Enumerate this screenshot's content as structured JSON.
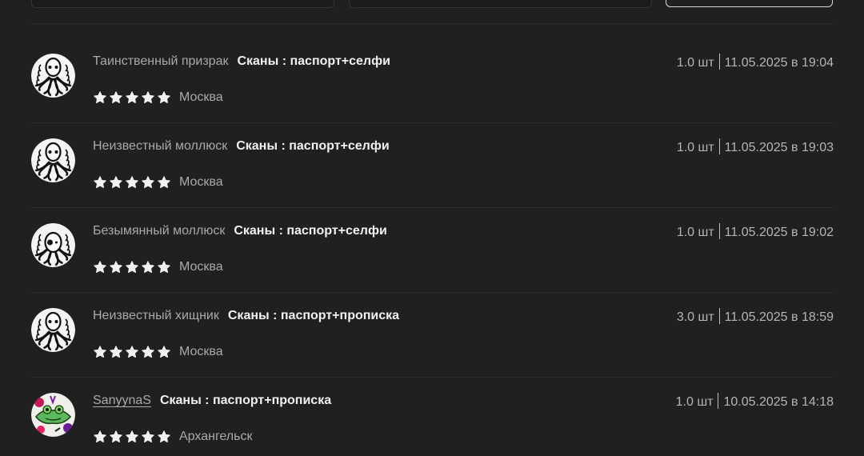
{
  "reviews": [
    {
      "username": "Таинственный призрак",
      "product": "Сканы : паспорт+селфи",
      "quantity": "1.0 шт",
      "datetime": "11.05.2025 в 19:04",
      "rating": 5,
      "city": "Москва",
      "avatar": "octopus-avatar"
    },
    {
      "username": "Неизвестный моллюск",
      "product": "Сканы : паспорт+селфи",
      "quantity": "1.0 шт",
      "datetime": "11.05.2025 в 19:03",
      "rating": 5,
      "city": "Москва",
      "avatar": "octopus-avatar"
    },
    {
      "username": "Безымянный моллюск",
      "product": "Сканы : паспорт+селфи",
      "quantity": "1.0 шт",
      "datetime": "11.05.2025 в 19:02",
      "rating": 5,
      "city": "Москва",
      "avatar": "octopus-avatar"
    },
    {
      "username": "Неизвестный хищник",
      "product": "Сканы : паспорт+прописка",
      "quantity": "3.0 шт",
      "datetime": "11.05.2025 в 18:59",
      "rating": 5,
      "city": "Москва",
      "avatar": "octopus-avatar"
    },
    {
      "username": "SanyynaS",
      "product": "Сканы : паспорт+прописка",
      "quantity": "1.0 шт",
      "datetime": "10.05.2025 в 14:18",
      "rating": 5,
      "city": "Архангельск",
      "avatar": "frog-avatar",
      "username_is_link": true
    }
  ],
  "colors": {
    "background": "#202020",
    "star": "#f2f2f2",
    "muted_text": "#a9a9a9"
  }
}
